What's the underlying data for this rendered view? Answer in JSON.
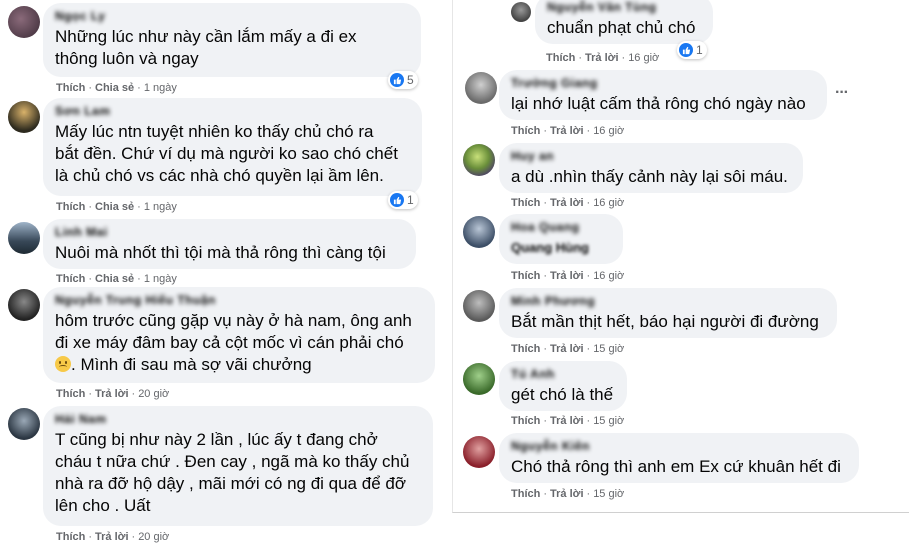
{
  "colors": {
    "bubble": "#f0f2f5",
    "meta": "#65676b",
    "like_blue": "#1877f2"
  },
  "left_comments": [
    {
      "name": "Ngọc Ly",
      "text": "Những lúc như này cần lắm mấy a đi ex\nthông luôn và ngay",
      "action1": "Thích",
      "action2": "Chia sẻ",
      "time": "1 ngày",
      "reactions": "5"
    },
    {
      "name": "Sơn Lam",
      "text": "Mấy lúc ntn tuyệt nhiên ko thấy chủ chó ra\nbắt đền. Chứ ví dụ mà người ko sao chó chết\nlà chủ chó vs các nhà chó quyền lại ầm lên.",
      "action1": "Thích",
      "action2": "Chia sẻ",
      "time": "1 ngày",
      "reactions": "1"
    },
    {
      "name": "Linh Mai",
      "text": "Nuôi mà nhốt thì tội mà thả rông thì càng tội",
      "action1": "Thích",
      "action2": "Chia sẻ",
      "time": "1 ngày"
    },
    {
      "name": "Nguyễn Trung Hiếu Thuận",
      "text_before": "hôm trước cũng gặp vụ này ở hà nam, ông anh\nđi xe máy đâm bay cả cột mốc vì cán phải chó\n",
      "text_after": ". Mình đi sau mà sợ vãi chưởng",
      "action1": "Thích",
      "action2": "Trả lời",
      "time": "20 giờ"
    },
    {
      "name": "Hải Nam",
      "text": "T cũng bị như này 2 lần , lúc ấy t đang chở\ncháu t nữa chứ . Đen cay , ngã mà ko thấy chủ\nnhà ra đỡ hộ dậy , mãi mới có ng đi qua để đỡ\nlên cho . Uất",
      "action1": "Thích",
      "action2": "Trả lời",
      "time": "20 giờ"
    }
  ],
  "right_comments": [
    {
      "name": "Nguyễn Văn Tùng",
      "text": "chuẩn phạt chủ chó",
      "action1": "Thích",
      "action2": "Trả lời",
      "time": "16 giờ",
      "reactions": "1"
    },
    {
      "name": "Trường Giang",
      "text": "lại nhớ luật cấm thả rông chó ngày nào",
      "action1": "Thích",
      "action2": "Trả lời",
      "time": "16 giờ"
    },
    {
      "name": "Huy an",
      "text": "a dù .nhìn thấy cảnh này lại sôi máu.",
      "action1": "Thích",
      "action2": "Trả lời",
      "time": "16 giờ"
    },
    {
      "name": "Hoa Quang",
      "text": "Quang Hùng",
      "action1": "Thích",
      "action2": "Trả lời",
      "time": "16 giờ"
    },
    {
      "name": "Minh Phương",
      "text": "Bắt mần thịt hết, báo hại người đi đường",
      "action1": "Thích",
      "action2": "Trả lời",
      "time": "15 giờ"
    },
    {
      "name": "Tú Anh",
      "text": "gét chó là thế",
      "action1": "Thích",
      "action2": "Trả lời",
      "time": "15 giờ"
    },
    {
      "name": "Nguyễn Kiên",
      "text": "Chó thả rông thì anh em Ex cứ khuân hết đi",
      "action1": "Thích",
      "action2": "Trả lời",
      "time": "15 giờ"
    }
  ]
}
